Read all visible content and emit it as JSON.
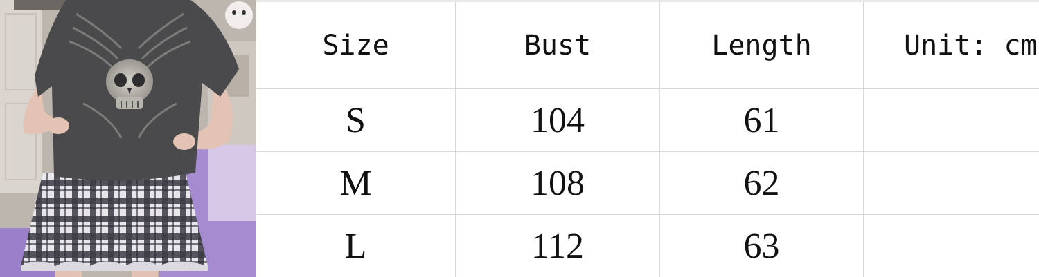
{
  "photo": {
    "alt": "Grey skull print tee with plaid skirt"
  },
  "size_chart": {
    "headers": [
      "Size",
      "Bust",
      "Length",
      "Unit: cm"
    ],
    "rows": [
      {
        "size": "S",
        "bust": "104",
        "length": "61",
        "note": ""
      },
      {
        "size": "M",
        "bust": "108",
        "length": "62",
        "note": ""
      },
      {
        "size": "L",
        "bust": "112",
        "length": "63",
        "note": ""
      }
    ]
  },
  "colors": {
    "grid_line": "#d9d9d9",
    "text": "#111111",
    "shirt": "#4a4a4c",
    "skirt_dark": "#3b3b44",
    "skirt_light": "#e8e6ea",
    "bedding": "#a58bd0"
  }
}
